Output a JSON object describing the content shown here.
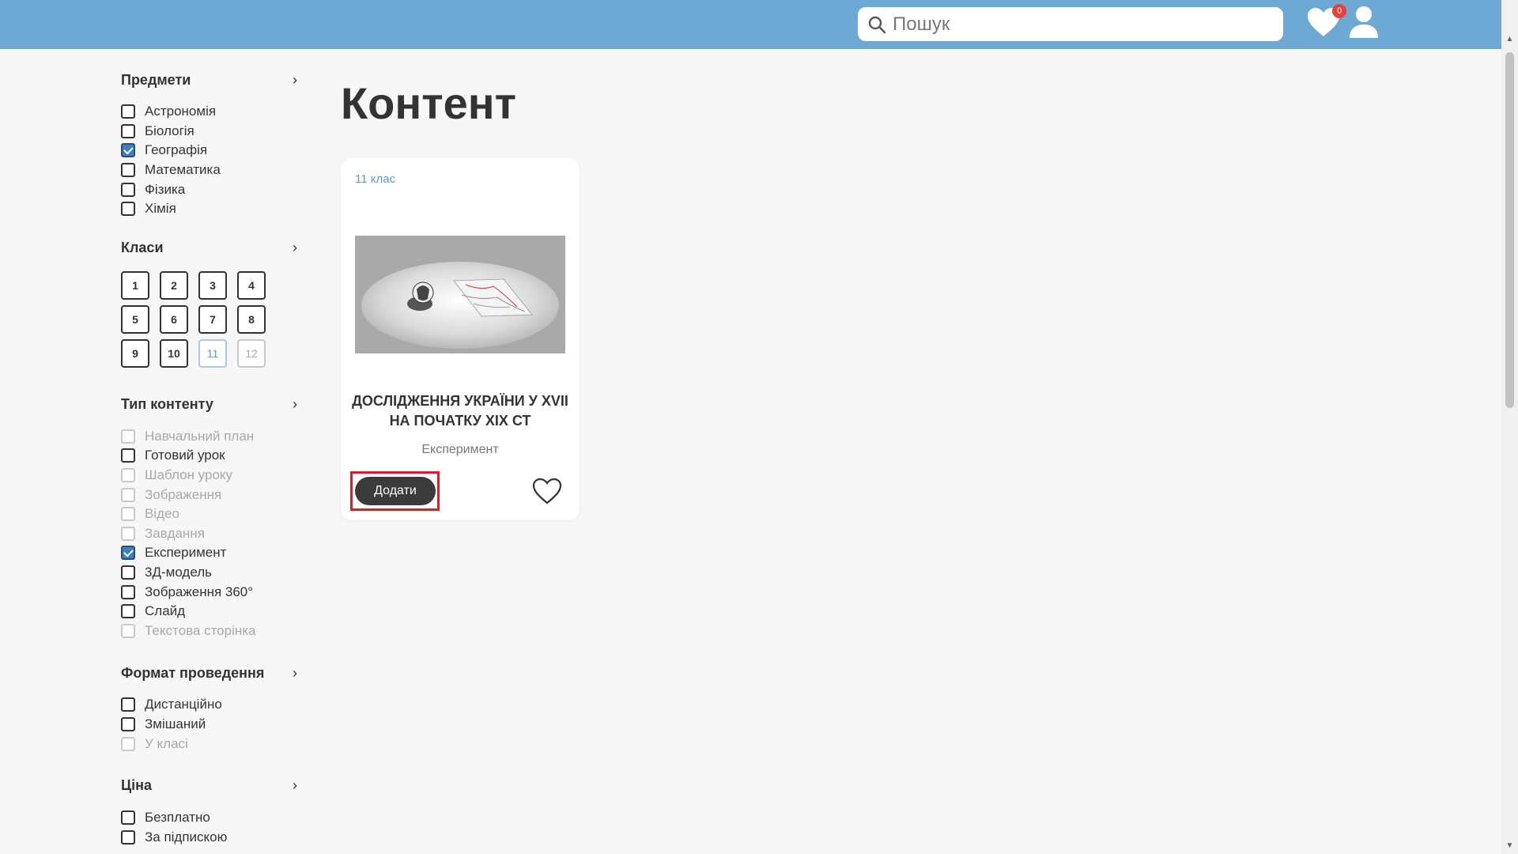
{
  "header": {
    "search_placeholder": "Пошук",
    "favorites_count": "0"
  },
  "sidebar": {
    "subjects": {
      "title": "Предмети",
      "items": [
        {
          "label": "Астрономія",
          "checked": false,
          "disabled": false
        },
        {
          "label": "Біологія",
          "checked": false,
          "disabled": false
        },
        {
          "label": "Географія",
          "checked": true,
          "disabled": false
        },
        {
          "label": "Математика",
          "checked": false,
          "disabled": false
        },
        {
          "label": "Фізика",
          "checked": false,
          "disabled": false
        },
        {
          "label": "Хімія",
          "checked": false,
          "disabled": false
        }
      ]
    },
    "grades": {
      "title": "Класи",
      "items": [
        {
          "label": "1",
          "state": "normal"
        },
        {
          "label": "2",
          "state": "normal"
        },
        {
          "label": "3",
          "state": "normal"
        },
        {
          "label": "4",
          "state": "normal"
        },
        {
          "label": "5",
          "state": "normal"
        },
        {
          "label": "6",
          "state": "normal"
        },
        {
          "label": "7",
          "state": "normal"
        },
        {
          "label": "8",
          "state": "normal"
        },
        {
          "label": "9",
          "state": "normal"
        },
        {
          "label": "10",
          "state": "normal"
        },
        {
          "label": "11",
          "state": "selected"
        },
        {
          "label": "12",
          "state": "disabled"
        }
      ]
    },
    "content_type": {
      "title": "Тип контенту",
      "items": [
        {
          "label": "Навчальний план",
          "checked": false,
          "disabled": true
        },
        {
          "label": "Готовий урок",
          "checked": false,
          "disabled": false
        },
        {
          "label": "Шаблон уроку",
          "checked": false,
          "disabled": true
        },
        {
          "label": "Зображення",
          "checked": false,
          "disabled": true
        },
        {
          "label": "Відео",
          "checked": false,
          "disabled": true
        },
        {
          "label": "Завдання",
          "checked": false,
          "disabled": true
        },
        {
          "label": "Експеримент",
          "checked": true,
          "disabled": false
        },
        {
          "label": "3Д-модель",
          "checked": false,
          "disabled": false
        },
        {
          "label": "Зображення 360°",
          "checked": false,
          "disabled": false
        },
        {
          "label": "Слайд",
          "checked": false,
          "disabled": false
        },
        {
          "label": "Текстова сторінка",
          "checked": false,
          "disabled": true
        }
      ]
    },
    "format": {
      "title": "Формат проведення",
      "items": [
        {
          "label": "Дистанційно",
          "checked": false,
          "disabled": false
        },
        {
          "label": "Змішаний",
          "checked": false,
          "disabled": false
        },
        {
          "label": "У класі",
          "checked": false,
          "disabled": true
        }
      ]
    },
    "price": {
      "title": "Ціна",
      "items": [
        {
          "label": "Безплатно",
          "checked": false,
          "disabled": false
        },
        {
          "label": "За підпискою",
          "checked": false,
          "disabled": false
        }
      ]
    }
  },
  "main": {
    "title": "Контент",
    "card": {
      "grade": "11 клас",
      "title": "ДОСЛІДЖЕННЯ УКРАЇНИ У XVII НА ПОЧАТКУ XIX СТ",
      "type": "Експеримент",
      "add_label": "Додати"
    }
  },
  "colors": {
    "header": "#6ea8d4",
    "accent": "#3d7fc1",
    "badge": "#e8403a",
    "highlight": "#e01b24"
  }
}
